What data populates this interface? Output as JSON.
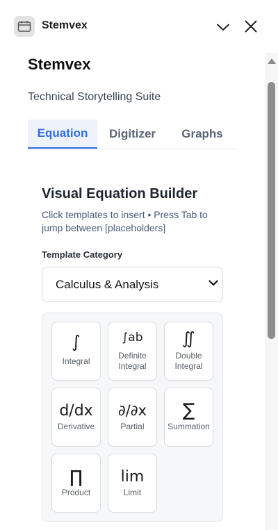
{
  "window": {
    "app_name": "Stemvex",
    "app_icon": "calendar-icon",
    "collapse_icon": "chevron-down-icon",
    "close_icon": "close-icon"
  },
  "panel": {
    "title": "Stemvex",
    "subtitle": "Technical Storytelling Suite"
  },
  "tabs": [
    {
      "label": "Equation",
      "active": true
    },
    {
      "label": "Digitizer",
      "active": false
    },
    {
      "label": "Graphs",
      "active": false
    }
  ],
  "builder": {
    "title": "Visual Equation Builder",
    "description": "Click templates to insert • Press Tab to jump between [placeholders]",
    "category_label": "Template Category",
    "category_value": "Calculus & Analysis"
  },
  "templates": [
    {
      "symbol": "∫",
      "label": "Integral"
    },
    {
      "symbol": "∫ab",
      "label": "Definite Integral"
    },
    {
      "symbol": "∬",
      "label": "Double Integral"
    },
    {
      "symbol": "d/dx",
      "label": "Derivative"
    },
    {
      "symbol": "∂/∂x",
      "label": "Partial"
    },
    {
      "symbol": "∑",
      "label": "Summation"
    },
    {
      "symbol": "∏",
      "label": "Product"
    },
    {
      "symbol": "lim",
      "label": "Limit"
    }
  ],
  "colors": {
    "accent": "#2f6fde",
    "tab_active_bg": "#eef3fb"
  }
}
